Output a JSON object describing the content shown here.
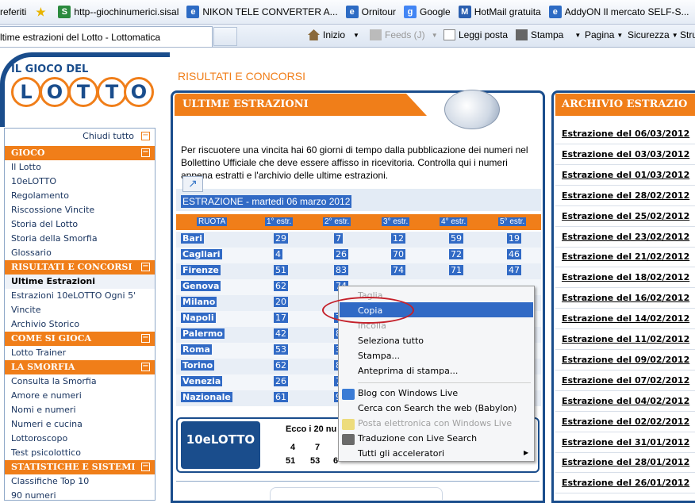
{
  "favorites": {
    "label": "referiti",
    "items": [
      {
        "label": "http--giochinumerici.sisal",
        "icon": "sisal-icon"
      },
      {
        "label": "NIKON TELE CONVERTER A...",
        "icon": "ie-icon"
      },
      {
        "label": "Ornitour",
        "icon": "ie-icon"
      },
      {
        "label": "Google",
        "icon": "google-icon"
      },
      {
        "label": "HotMail gratuita",
        "icon": "hotmail-icon"
      },
      {
        "label": "AddyON  Il mercato SELF-S...",
        "icon": "ie-icon"
      }
    ]
  },
  "tab": {
    "title": "ltime estrazioni del Lotto - Lottomatica"
  },
  "commandbar": {
    "home": "Inizio",
    "feeds": "Feeds (J)",
    "read_mail": "Leggi posta",
    "print": "Stampa",
    "page": "Pagina",
    "safety": "Sicurezza",
    "tools": "Stru"
  },
  "logo": {
    "top": "IL GIOCO DEL",
    "letters": [
      "L",
      "O",
      "T",
      "T",
      "O"
    ]
  },
  "header": {
    "title": "RISULTATI E CONCORSI"
  },
  "sidebar": {
    "close_all": "Chiudi tutto",
    "items": [
      {
        "label": "GIOCO",
        "type": "section"
      },
      {
        "label": "Il Lotto",
        "type": "item"
      },
      {
        "label": "10eLOTTO",
        "type": "item"
      },
      {
        "label": "Regolamento",
        "type": "item"
      },
      {
        "label": "Riscossione Vincite",
        "type": "item"
      },
      {
        "label": "Storia del Lotto",
        "type": "item"
      },
      {
        "label": "Storia della Smorfia",
        "type": "item"
      },
      {
        "label": "Glossario",
        "type": "item"
      },
      {
        "label": "RISULTATI E CONCORSI",
        "type": "section"
      },
      {
        "label": "Ultime Estrazioni",
        "type": "selected"
      },
      {
        "label": "Estrazioni 10eLOTTO Ogni 5'",
        "type": "item"
      },
      {
        "label": "Vincite",
        "type": "item"
      },
      {
        "label": "Archivio Storico",
        "type": "item"
      },
      {
        "label": "COME SI GIOCA",
        "type": "section"
      },
      {
        "label": "Lotto Trainer",
        "type": "item"
      },
      {
        "label": "LA SMORFIA",
        "type": "section"
      },
      {
        "label": "Consulta la Smorfia",
        "type": "item"
      },
      {
        "label": "Amore e numeri",
        "type": "item"
      },
      {
        "label": "Nomi e numeri",
        "type": "item"
      },
      {
        "label": "Numeri e cucina",
        "type": "item"
      },
      {
        "label": "Lottoroscopo",
        "type": "item"
      },
      {
        "label": "Test psicolottico",
        "type": "item"
      },
      {
        "label": "STATISTICHE E SISTEMI",
        "type": "section"
      },
      {
        "label": "Classifiche Top 10",
        "type": "item"
      },
      {
        "label": "90 numeri",
        "type": "item"
      }
    ]
  },
  "main": {
    "title": "ULTIME ESTRAZIONI",
    "intro": "Per riscuotere una vincita hai 60 giorni di tempo dalla pubblicazione dei numeri nel Bollettino Ufficiale che deve essere affisso in ricevitoria. Controlla qui i numeri appena estratti e l'archivio delle ultime estrazioni.",
    "estrazione": "ESTRAZIONE - martedì 06 marzo 2012",
    "headers": [
      "RUOTA",
      "1° estr.",
      "2° estr.",
      "3° estr.",
      "4° estr.",
      "5° estr."
    ],
    "rows": [
      {
        "ruota": "Bari",
        "n": [
          "29",
          "7",
          "12",
          "59",
          "19"
        ]
      },
      {
        "ruota": "Cagliari",
        "n": [
          "4",
          "26",
          "70",
          "72",
          "46"
        ]
      },
      {
        "ruota": "Firenze",
        "n": [
          "51",
          "83",
          "74",
          "71",
          "47"
        ]
      },
      {
        "ruota": "Genova",
        "n": [
          "62",
          "74",
          "",
          "",
          ""
        ]
      },
      {
        "ruota": "Milano",
        "n": [
          "20",
          "",
          "",
          "",
          ""
        ]
      },
      {
        "ruota": "Napoli",
        "n": [
          "17",
          "7",
          "",
          "",
          ""
        ]
      },
      {
        "ruota": "Palermo",
        "n": [
          "42",
          "8",
          "",
          "",
          ""
        ]
      },
      {
        "ruota": "Roma",
        "n": [
          "53",
          "3",
          "",
          "",
          ""
        ]
      },
      {
        "ruota": "Torino",
        "n": [
          "62",
          "8",
          "",
          "",
          ""
        ]
      },
      {
        "ruota": "Venezia",
        "n": [
          "26",
          "7",
          "",
          "",
          ""
        ]
      },
      {
        "ruota": "Nazionale",
        "n": [
          "61",
          "9",
          "",
          "",
          ""
        ]
      }
    ],
    "dieci": {
      "logo": "10eLOTTO",
      "text": "Ecco i 20 nu",
      "row1": [
        "4",
        "7"
      ],
      "row2": [
        "51",
        "53",
        "6"
      ]
    }
  },
  "archive": {
    "title": "ARCHIVIO ESTRAZIO",
    "items": [
      "Estrazione del 06/03/2012",
      "Estrazione del 03/03/2012",
      "Estrazione del 01/03/2012",
      "Estrazione del 28/02/2012",
      "Estrazione del 25/02/2012",
      "Estrazione del 23/02/2012",
      "Estrazione del 21/02/2012",
      "Estrazione del 18/02/2012",
      "Estrazione del 16/02/2012",
      "Estrazione del 14/02/2012",
      "Estrazione del 11/02/2012",
      "Estrazione del 09/02/2012",
      "Estrazione del 07/02/2012",
      "Estrazione del 04/02/2012",
      "Estrazione del 02/02/2012",
      "Estrazione del 31/01/2012",
      "Estrazione del 28/01/2012",
      "Estrazione del 26/01/2012"
    ]
  },
  "context_menu": {
    "items": [
      {
        "label": "Taglia",
        "disabled": true
      },
      {
        "label": "Copia",
        "disabled": false,
        "selected": true
      },
      {
        "label": "Incolla",
        "disabled": true
      },
      {
        "label": "Seleziona tutto",
        "disabled": false
      },
      {
        "label": "Stampa...",
        "disabled": false
      },
      {
        "label": "Anteprima di stampa...",
        "disabled": false
      },
      {
        "label": "Blog con Windows Live",
        "disabled": false,
        "icon": "windows-live-icon"
      },
      {
        "label": "Cerca con Search the web (Babylon)",
        "disabled": false
      },
      {
        "label": "Posta elettronica con Windows Live",
        "disabled": true,
        "icon": "mail-icon"
      },
      {
        "label": "Traduzione con Live Search",
        "disabled": false,
        "icon": "translate-icon"
      },
      {
        "label": "Tutti gli acceleratori",
        "disabled": false,
        "submenu": true
      }
    ]
  },
  "colors": {
    "orange": "#f07e19",
    "navy": "#1a4d8c",
    "selection": "#316ac5",
    "annotation": "#c4202a"
  }
}
